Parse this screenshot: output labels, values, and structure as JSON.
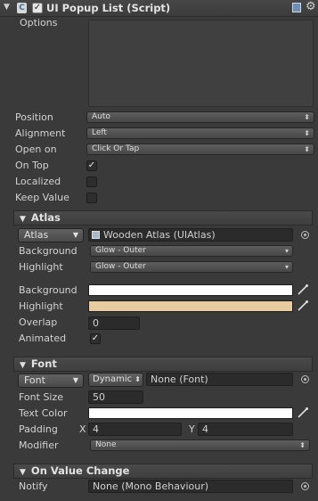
{
  "header": {
    "title": "UI Popup List (Script)",
    "enabled": true
  },
  "options": {
    "label": "Options",
    "position": {
      "label": "Position",
      "value": "Auto"
    },
    "alignment": {
      "label": "Alignment",
      "value": "Left"
    },
    "open_on": {
      "label": "Open on",
      "value": "Click Or Tap"
    },
    "on_top": {
      "label": "On Top",
      "checked": true
    },
    "localized": {
      "label": "Localized",
      "checked": false
    },
    "keep_value": {
      "label": "Keep Value",
      "checked": false
    }
  },
  "atlas_section": {
    "title": "Atlas",
    "type_dropdown": "Atlas",
    "atlas_value": "Wooden Atlas (UIAtlas)",
    "background": {
      "label": "Background",
      "value": "Glow - Outer"
    },
    "highlight": {
      "label": "Highlight",
      "value": "Glow - Outer"
    },
    "background_color": {
      "label": "Background",
      "color": "#ffffff"
    },
    "highlight_color": {
      "label": "Highlight",
      "color": "#e8cb9e"
    },
    "overlap": {
      "label": "Overlap",
      "value": "0"
    },
    "animated": {
      "label": "Animated",
      "checked": true
    }
  },
  "font_section": {
    "title": "Font",
    "type_dropdown": "Font",
    "font_mode": "Dynamic",
    "font_value": "None (Font)",
    "font_size": {
      "label": "Font Size",
      "value": "50"
    },
    "text_color": {
      "label": "Text Color",
      "color": "#ffffff"
    },
    "padding": {
      "label": "Padding",
      "x_label": "X",
      "x": "4",
      "y_label": "Y",
      "y": "4"
    },
    "modifier": {
      "label": "Modifier",
      "value": "None"
    }
  },
  "value_change_section": {
    "title": "On Value Change",
    "notify": {
      "label": "Notify",
      "value": "None (Mono Behaviour)"
    }
  },
  "icons": {
    "script_icon": "script-icon",
    "book_icon": "book-icon",
    "gear_icon": "gear-icon",
    "eyedropper_icon": "eyedropper-icon",
    "object_picker_icon": "object-picker-icon",
    "atlas_asset_icon": "atlas-asset-icon"
  }
}
